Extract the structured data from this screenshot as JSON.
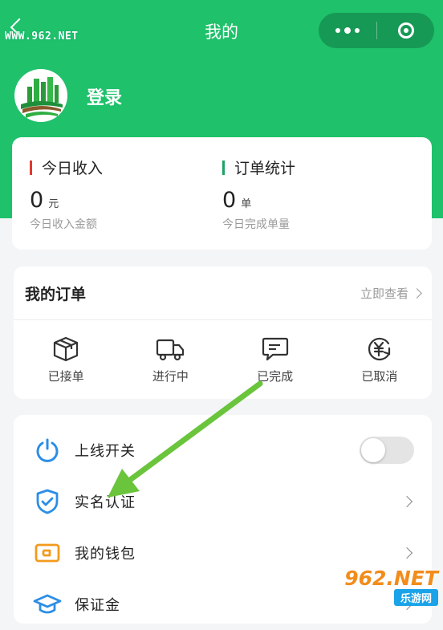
{
  "watermark_top": "WWW.962.NET",
  "header": {
    "title": "我的"
  },
  "profile": {
    "login_label": "登录"
  },
  "stats": {
    "income": {
      "title": "今日收入",
      "value": "0",
      "unit": "元",
      "desc": "今日收入金额",
      "accent": "#e23a2f"
    },
    "orders": {
      "title": "订单统计",
      "value": "0",
      "unit": "单",
      "desc": "今日完成单量",
      "accent": "#1aa364"
    }
  },
  "my_orders": {
    "title": "我的订单",
    "view_all": "立即查看",
    "items": [
      {
        "label": "已接单",
        "icon": "package-icon"
      },
      {
        "label": "进行中",
        "icon": "truck-icon"
      },
      {
        "label": "已完成",
        "icon": "chat-box-icon"
      },
      {
        "label": "已取消",
        "icon": "yen-refresh-icon"
      }
    ]
  },
  "menu": [
    {
      "label": "上线开关",
      "icon": "power-icon",
      "icon_color": "#2c8ee6",
      "control": "toggle",
      "toggle_on": false
    },
    {
      "label": "实名认证",
      "icon": "shield-check-icon",
      "icon_color": "#2c8ee6",
      "control": "chevron"
    },
    {
      "label": "我的钱包",
      "icon": "wallet-icon",
      "icon_color": "#f39a1d",
      "control": "chevron"
    },
    {
      "label": "保证金",
      "icon": "graduation-cap-icon",
      "icon_color": "#2c8ee6",
      "control": "chevron"
    }
  ],
  "watermark_corner": {
    "main": "962.NET",
    "sub": "乐游网"
  },
  "colors": {
    "primary_green": "#1fc16b",
    "arrow_green": "#6ac43c"
  }
}
